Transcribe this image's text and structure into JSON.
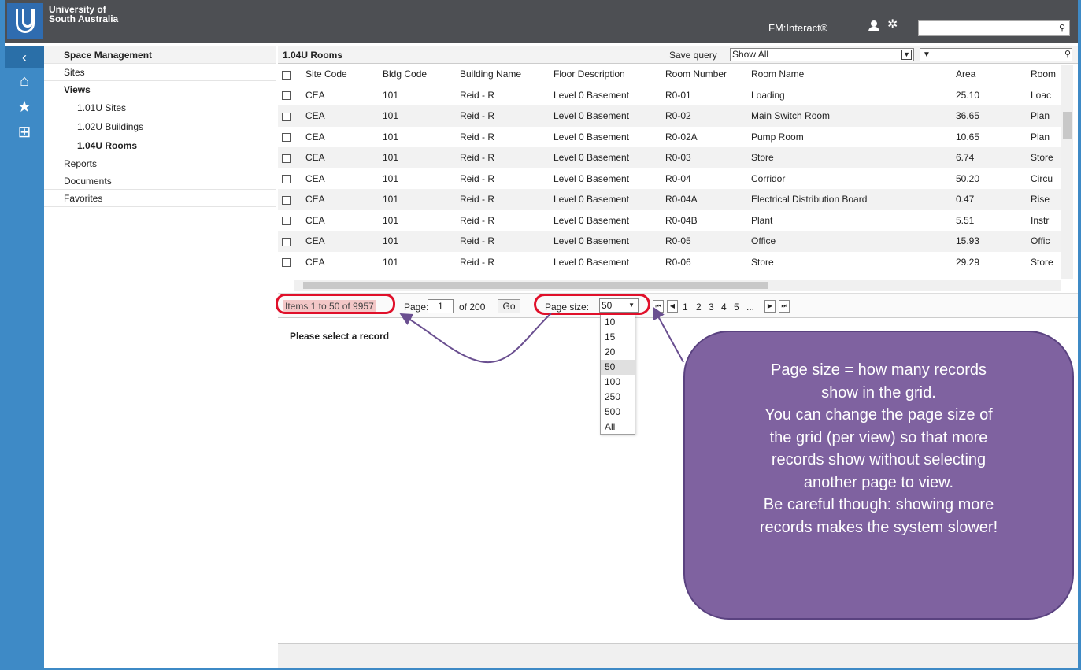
{
  "header": {
    "university_name": "University of\nSouth Australia",
    "brand": "FM:Interact®",
    "search_value": ""
  },
  "icon_sidebar": {
    "items": [
      {
        "name": "collapse-icon",
        "glyph": "‹"
      },
      {
        "name": "home-icon",
        "glyph": "⌂"
      },
      {
        "name": "star-icon",
        "glyph": "★"
      },
      {
        "name": "floorplan-icon",
        "glyph": "⊞"
      }
    ]
  },
  "nav": {
    "space_management": "Space Management",
    "sites": "Sites",
    "views": "Views",
    "view_items": [
      "1.01U Sites",
      "1.02U Buildings",
      "1.04U Rooms"
    ],
    "reports": "Reports",
    "documents": "Documents",
    "favorites": "Favorites"
  },
  "grid": {
    "title": "1.04U Rooms",
    "save_query_label": "Save query",
    "query_value": "Show All",
    "search_value": "",
    "columns": [
      "Site Code",
      "Bldg Code",
      "Building Name",
      "Floor Description",
      "Room Number",
      "Room Name",
      "Area",
      "Room"
    ],
    "rows": [
      [
        "CEA",
        "101",
        "Reid - R",
        "Level 0 Basement",
        "R0-01",
        "Loading",
        "25.10",
        "Loac"
      ],
      [
        "CEA",
        "101",
        "Reid - R",
        "Level 0 Basement",
        "R0-02",
        "Main Switch Room",
        "36.65",
        "Plan"
      ],
      [
        "CEA",
        "101",
        "Reid - R",
        "Level 0 Basement",
        "R0-02A",
        "Pump Room",
        "10.65",
        "Plan"
      ],
      [
        "CEA",
        "101",
        "Reid - R",
        "Level 0 Basement",
        "R0-03",
        "Store",
        "6.74",
        "Store"
      ],
      [
        "CEA",
        "101",
        "Reid - R",
        "Level 0 Basement",
        "R0-04",
        "Corridor",
        "50.20",
        "Circu"
      ],
      [
        "CEA",
        "101",
        "Reid - R",
        "Level 0 Basement",
        "R0-04A",
        "Electrical Distribution Board",
        "0.47",
        "Rise"
      ],
      [
        "CEA",
        "101",
        "Reid - R",
        "Level 0 Basement",
        "R0-04B",
        "Plant",
        "5.51",
        "Instr"
      ],
      [
        "CEA",
        "101",
        "Reid - R",
        "Level 0 Basement",
        "R0-05",
        "Office",
        "15.93",
        "Offic"
      ],
      [
        "CEA",
        "101",
        "Reid - R",
        "Level 0 Basement",
        "R0-06",
        "Store",
        "29.29",
        "Store"
      ]
    ]
  },
  "pager": {
    "items_text": "Items 1 to 50 of 9957",
    "page_label": "Page:",
    "page_value": "1",
    "of_text": "of 200",
    "go_label": "Go",
    "page_size_label": "Page size:",
    "page_size_value": "50",
    "page_numbers": [
      "1",
      "2",
      "3",
      "4",
      "5",
      "..."
    ],
    "page_size_options": [
      "10",
      "15",
      "20",
      "50",
      "100",
      "250",
      "500",
      "All"
    ]
  },
  "detail": {
    "message": "Please select a record"
  },
  "callout": {
    "lines": [
      "Page size = how many records",
      "show in the grid.",
      "You can change the page size of",
      "the grid (per view) so that more",
      "records show without selecting",
      "another page to view.",
      "Be careful though:  showing more",
      "records makes the system slower!"
    ]
  },
  "colors": {
    "accent_blue": "#3e8ac6",
    "topbar": "#4d4f53",
    "callout_purple": "#7f62a0",
    "highlight_red": "#e0102a"
  }
}
